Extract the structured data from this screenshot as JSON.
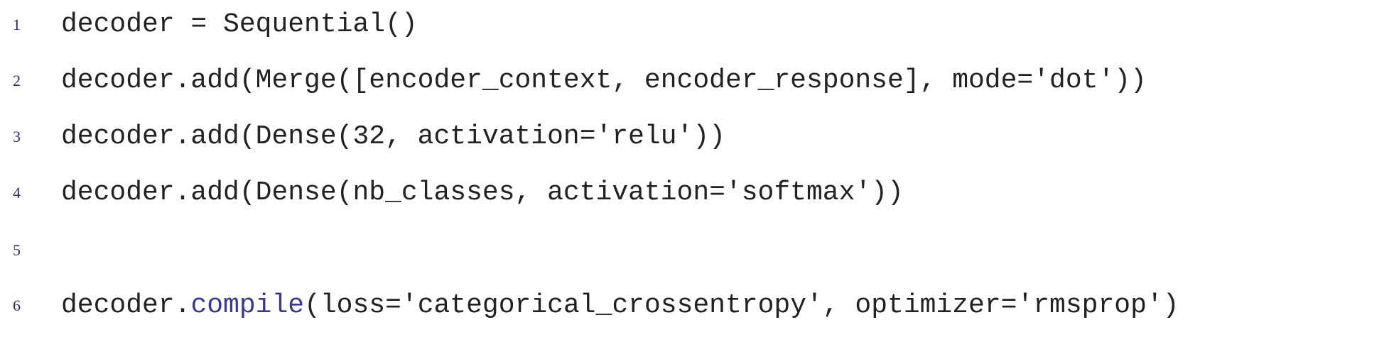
{
  "lines": [
    {
      "number": "1",
      "code": "decoder = Sequential()"
    },
    {
      "number": "2",
      "code": "decoder.add(Merge([encoder_context, encoder_response], mode='dot'))"
    },
    {
      "number": "3",
      "code": "decoder.add(Dense(32, activation='relu'))"
    },
    {
      "number": "4",
      "code": "decoder.add(Dense(nb_classes, activation='softmax'))"
    },
    {
      "number": "5",
      "code": ""
    },
    {
      "number": "6",
      "code_prefix": "decoder.",
      "code_keyword": "compile",
      "code_suffix": "(loss='categorical_crossentropy', optimizer='rmsprop')"
    }
  ],
  "colors": {
    "text": "#222222",
    "line_number": "#2b2b6b",
    "keyword": "#3a3a8c",
    "background": "#ffffff"
  }
}
